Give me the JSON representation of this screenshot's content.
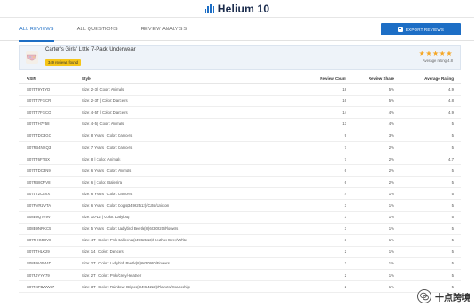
{
  "app": {
    "logo_text": "Helium 10"
  },
  "tabs": [
    {
      "label": "ALL REVIEWS",
      "active": true
    },
    {
      "label": "ALL QUESTIONS",
      "active": false
    },
    {
      "label": "REVIEW ANALYSIS",
      "active": false
    }
  ],
  "export_label": "EXPORT REVIEWS",
  "product": {
    "title": "Carter's Girls' Little 7-Pack Underwear",
    "reviews_found": "349 reviews found",
    "stars": "★★★★★",
    "rating_label": "Average rating 4.8"
  },
  "table": {
    "headers": {
      "asin": "ASIN",
      "style": "Style",
      "count": "Review Count",
      "share": "Review Share",
      "rating": "Average Rating"
    },
    "rows": [
      {
        "asin": "B075T9Y4YD",
        "style": "Size: 2-3 | Color: Animals",
        "count": "18",
        "share": "5%",
        "rating": "4.9"
      },
      {
        "asin": "B075T7FGCR",
        "style": "Size: 2-3T | Color: Dancers",
        "count": "16",
        "share": "5%",
        "rating": "4.8"
      },
      {
        "asin": "B075T7FGCQ",
        "style": "Size: 4-5T | Color: Dancers",
        "count": "14",
        "share": "4%",
        "rating": "4.9"
      },
      {
        "asin": "B075TH7F58",
        "style": "Size: 4-5 | Color: Animals",
        "count": "13",
        "share": "4%",
        "rating": "5"
      },
      {
        "asin": "B075TDC3GC",
        "style": "Size: 8 Years | Color: Dancers",
        "count": "9",
        "share": "3%",
        "rating": "5"
      },
      {
        "asin": "B07FB4NXQ3",
        "style": "Size: 7 Years | Color: Dancers",
        "count": "7",
        "share": "2%",
        "rating": "5"
      },
      {
        "asin": "B075T6FTBX",
        "style": "Size: 8 | Color: Animals",
        "count": "7",
        "share": "2%",
        "rating": "4.7"
      },
      {
        "asin": "B075TDC3N9",
        "style": "Size: 6 Years | Color: Animals",
        "count": "6",
        "share": "2%",
        "rating": "5"
      },
      {
        "asin": "B07FB8CFV8",
        "style": "Size: 6 | Color: Ballerina",
        "count": "6",
        "share": "2%",
        "rating": "5"
      },
      {
        "asin": "B075T2C6XX",
        "style": "Size: 6 Years | Color: Dancers",
        "count": "4",
        "share": "1%",
        "rating": "5"
      },
      {
        "asin": "B07PVRZVTA",
        "style": "Size: 6 Years | Color: Dogs(34962512)/Cats/Unicorn",
        "count": "3",
        "share": "1%",
        "rating": "5"
      },
      {
        "asin": "B08B9Q7Y9V",
        "style": "Size: 10-12 | Color: Ladybug",
        "count": "3",
        "share": "1%",
        "rating": "5"
      },
      {
        "asin": "B08B9NRKC5",
        "style": "Size: 5 Years | Color: Ladybird Beetle(8)6030920/Flowers",
        "count": "3",
        "share": "1%",
        "rating": "5"
      },
      {
        "asin": "B07FHG5DV8",
        "style": "Size: 4T | Color: Pink Ballerina(34962513)/Heather Grey/White",
        "count": "3",
        "share": "1%",
        "rating": "5"
      },
      {
        "asin": "B075THLX29",
        "style": "Size: 14 | Color: Dancers",
        "count": "2",
        "share": "1%",
        "rating": "5"
      },
      {
        "asin": "B08B9VW44D",
        "style": "Size: 2T | Color: Ladybird Beetle(8)6030920/Flowers",
        "count": "2",
        "share": "1%",
        "rating": "5"
      },
      {
        "asin": "B07FJYYY79",
        "style": "Size: 2T | Color: Pink/Grey/Heather",
        "count": "2",
        "share": "1%",
        "rating": "5"
      },
      {
        "asin": "B07P4FBWW47",
        "style": "Size: 3T | Color: Rainbow Stripes(34964212)/Planets/Spaceship",
        "count": "2",
        "share": "1%",
        "rating": "5"
      }
    ]
  },
  "watermark": {
    "text": "十点跨境"
  },
  "colors": {
    "accent": "#1d6ec5",
    "badge": "#f5c518",
    "star": "#f5a623",
    "product_bg": "#eef3f9"
  }
}
